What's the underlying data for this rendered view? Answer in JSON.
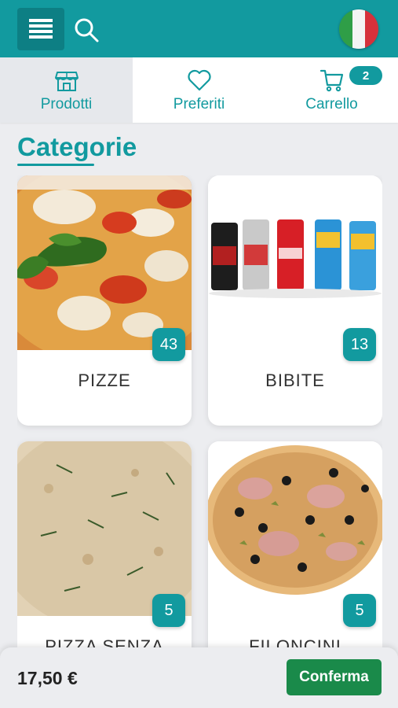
{
  "header": {
    "menu_icon": "hamburger-menu-icon",
    "search_icon": "search-icon",
    "language_flag": "italian-flag-icon",
    "color": "#129a9f"
  },
  "tabs": [
    {
      "label": "Prodotti",
      "icon": "store-icon",
      "active": true
    },
    {
      "label": "Preferiti",
      "icon": "heart-icon",
      "active": false
    },
    {
      "label": "Carrello",
      "icon": "cart-icon",
      "active": false,
      "badge": "2"
    }
  ],
  "section": {
    "title": "Categorie"
  },
  "categories": [
    {
      "name": "PIZZE",
      "count": "43",
      "image": "margherita-pizza"
    },
    {
      "name": "BIBITE",
      "count": "13",
      "image": "soda-cans"
    },
    {
      "name": "PIZZA SENZA",
      "count": "5",
      "image": "focaccia-rosemary"
    },
    {
      "name": "FILONCINI",
      "count": "5",
      "image": "capricciosa-pizza"
    }
  ],
  "footer": {
    "total": "17,50 €",
    "confirm_label": "Conferma",
    "confirm_color": "#1a8a4a"
  }
}
